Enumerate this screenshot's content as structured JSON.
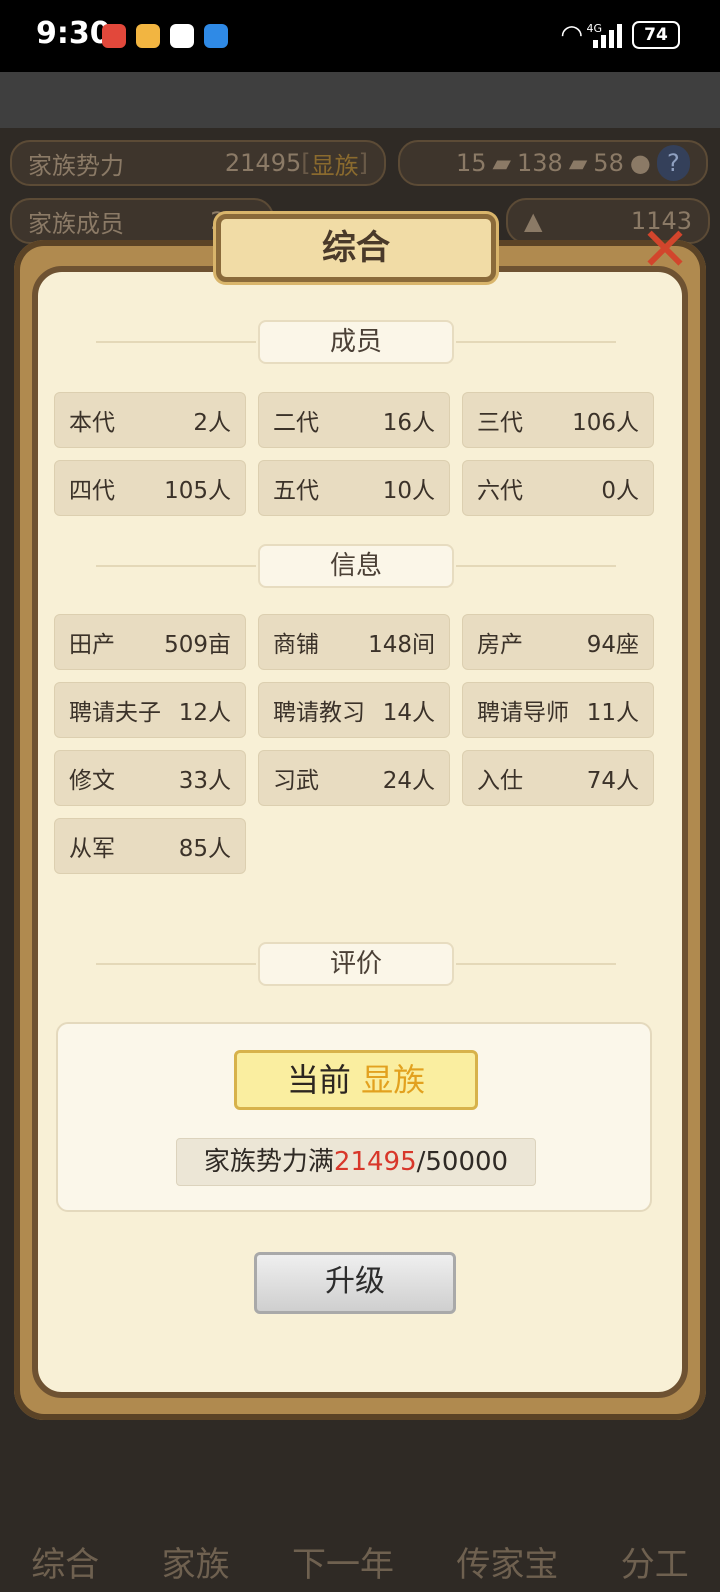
{
  "status_bar": {
    "time": "9:30",
    "network": "4G",
    "battery": "74"
  },
  "background": {
    "power_label": "家族势力",
    "power_value": "21495",
    "power_rank_open": "[",
    "power_rank": "显族",
    "power_rank_close": "]",
    "members_label": "家族成员",
    "members_value": "237",
    "res_wood": "15",
    "res_gold": "138",
    "res_book": "58",
    "res_silver": "1143",
    "help": "?",
    "nav": [
      "综合",
      "家族",
      "下一年",
      "传家宝",
      "分工"
    ]
  },
  "modal": {
    "title": "综合",
    "close_glyph": "✕",
    "members_header": "成员",
    "members": [
      {
        "label": "本代",
        "value": "2人"
      },
      {
        "label": "二代",
        "value": "16人"
      },
      {
        "label": "三代",
        "value": "106人"
      },
      {
        "label": "四代",
        "value": "105人"
      },
      {
        "label": "五代",
        "value": "10人"
      },
      {
        "label": "六代",
        "value": "0人"
      }
    ],
    "info_header": "信息",
    "info": [
      {
        "label": "田产",
        "value": "509亩"
      },
      {
        "label": "商铺",
        "value": "148间"
      },
      {
        "label": "房产",
        "value": "94座"
      },
      {
        "label": "聘请夫子",
        "value": "12人"
      },
      {
        "label": "聘请教习",
        "value": "14人"
      },
      {
        "label": "聘请导师",
        "value": "11人"
      },
      {
        "label": "修文",
        "value": "33人"
      },
      {
        "label": "习武",
        "value": "24人"
      },
      {
        "label": "入仕",
        "value": "74人"
      },
      {
        "label": "从军",
        "value": "85人"
      }
    ],
    "rating_header": "评价",
    "rating": {
      "current_label": "当前",
      "current_rank": "显族",
      "progress_label": "家族势力满",
      "progress_current": "21495",
      "progress_sep": "/",
      "progress_max": "50000"
    },
    "upgrade_label": "升级"
  }
}
